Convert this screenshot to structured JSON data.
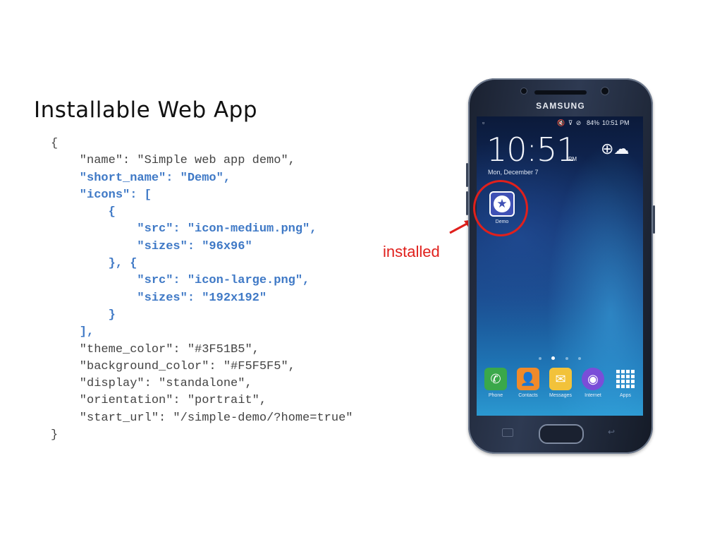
{
  "slide": {
    "title": "Installable Web App"
  },
  "code_lines": [
    "{",
    "    \"name\": \"Simple web app demo\",",
    "    \"short_name\": \"Demo\",",
    "    \"icons\": [",
    "        {",
    "            \"src\": \"icon-medium.png\",",
    "            \"sizes\": \"96x96\"",
    "        }, {",
    "            \"src\": \"icon-large.png\",",
    "            \"sizes\": \"192x192\"",
    "        }",
    "    ],",
    "    \"theme_color\": \"#3F51B5\",",
    "    \"background_color\": \"#F5F5F5\",",
    "    \"display\": \"standalone\",",
    "    \"orientation\": \"portrait\",",
    "    \"start_url\": \"/simple-demo/?home=true\"",
    "}"
  ],
  "highlighted_line_indices": [
    2,
    3,
    4,
    5,
    6,
    7,
    8,
    9,
    10,
    11
  ],
  "annotation": {
    "label": "installed",
    "color": "#e0201c"
  },
  "phone": {
    "brand": "SAMSUNG",
    "status_bar": {
      "battery": "84%",
      "time": "10:51 PM"
    },
    "lock": {
      "time": "10:51",
      "ampm": "PM",
      "date": "Mon, December 7"
    },
    "installed_app": {
      "label": "Demo",
      "icon": "star-icon",
      "color": "#3F51B5"
    },
    "dock": [
      {
        "label": "Phone",
        "icon": "phone-icon",
        "color": "#3aa84a"
      },
      {
        "label": "Contacts",
        "icon": "contacts-icon",
        "color": "#f08a2a"
      },
      {
        "label": "Messages",
        "icon": "messages-icon",
        "color": "#f2c23a"
      },
      {
        "label": "Internet",
        "icon": "internet-icon",
        "color": "#7a4ed8"
      },
      {
        "label": "Apps",
        "icon": "apps-grid-icon",
        "color": "#ffffff"
      }
    ]
  }
}
